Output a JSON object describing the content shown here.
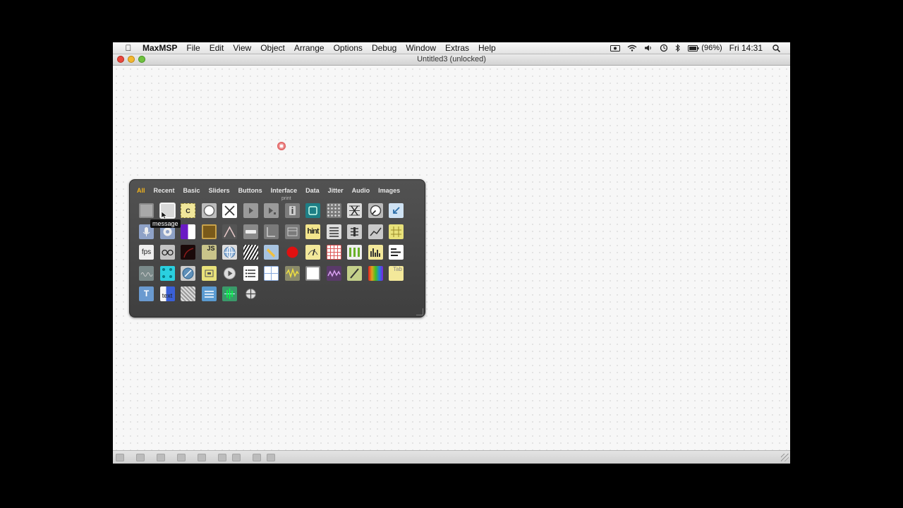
{
  "menubar": {
    "app": "MaxMSP",
    "items": [
      "File",
      "Edit",
      "View",
      "Object",
      "Arrange",
      "Options",
      "Debug",
      "Window",
      "Extras",
      "Help"
    ],
    "battery": "(96%)",
    "clock": "Fri 14:31"
  },
  "window": {
    "title": "Untitled3 (unlocked)"
  },
  "palette": {
    "tabs": [
      "All",
      "Recent",
      "Basic",
      "Sliders",
      "Buttons",
      "Interface",
      "Data",
      "Jitter",
      "Audio",
      "Images"
    ],
    "active_tab": "All",
    "tooltip": "message",
    "print_label": "print",
    "icon_text": {
      "fps": "fps",
      "hint": "hint",
      "text": "text",
      "js": "JS",
      "t": "T",
      "c": "C",
      "tab": "Tab"
    }
  },
  "colors": {
    "accent": "#f2b41c",
    "palette_bg": "#4a4a4a",
    "canvas": "#f7f7f7"
  }
}
